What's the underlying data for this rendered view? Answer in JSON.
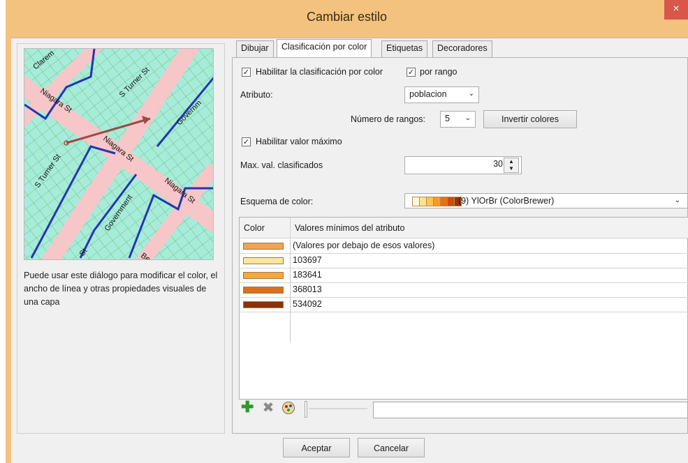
{
  "window": {
    "title": "Cambiar estilo",
    "close_glyph": "×"
  },
  "left_panel": {
    "description": "Puede usar este diálogo para modificar el color, el ancho de línea y otras propiedades visuales de una capa",
    "map_labels": [
      "Clarem",
      "S Turner St",
      "Niagara St",
      "Governm",
      "Niagara St",
      "S Turner St",
      "Niagara St",
      "Niagara St",
      "Government",
      "St",
      "Be"
    ]
  },
  "tabs": [
    {
      "label": "Dibujar"
    },
    {
      "label": "Clasificación por color"
    },
    {
      "label": "Etiquetas"
    },
    {
      "label": "Decoradores"
    }
  ],
  "form": {
    "enable_classification_label": "Habilitar la clasificación por color",
    "by_range_label": "por rango",
    "attribute_label": "Atributo:",
    "attribute_value": "poblacion",
    "num_ranges_label": "Número de rangos:",
    "num_ranges_value": "5",
    "invert_colors_label": "Invertir colores",
    "enable_max_label": "Habilitar valor máximo",
    "max_label": "Max. val. clasificados",
    "max_value": "30",
    "scheme_label": "Esquema de color:",
    "scheme_value": "(9) YlOrBr (ColorBrewer)"
  },
  "table": {
    "col_color": "Color",
    "col_values": "Valores mínimos del atributo",
    "rows": [
      {
        "value": "(Valores por debajo de esos valores)",
        "color": "#f0a256"
      },
      {
        "value": "103697",
        "color": "#fde59a"
      },
      {
        "value": "183641",
        "color": "#f7a73f"
      },
      {
        "value": "368013",
        "color": "#dd6e1a"
      },
      {
        "value": "534092",
        "color": "#8c3206"
      }
    ]
  },
  "buttons": {
    "ok": "Aceptar",
    "cancel": "Cancelar"
  },
  "colors": {
    "title_bar": "#f4c27f",
    "close": "#d9564a",
    "scheme_swatches": [
      "#fff7d6",
      "#fee391",
      "#fec44f",
      "#fe9929",
      "#ec7014",
      "#cc4c02",
      "#993404"
    ]
  }
}
